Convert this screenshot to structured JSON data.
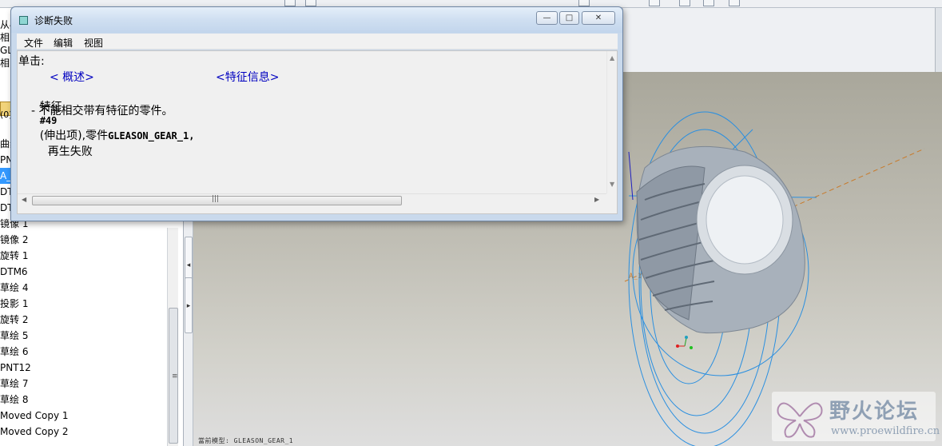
{
  "dialog": {
    "title": "诊断失败",
    "buttons": {
      "minimize": "—",
      "maximize": "□",
      "close": "✕"
    },
    "menu": [
      "文件",
      "编辑",
      "视图"
    ],
    "content": {
      "click_label": "单击:",
      "link_overview": "< 概述>",
      "link_feature_info": "<特征信息>",
      "feature_prefix": "特征",
      "feature_id": "#49",
      "feature_type": "(伸出项),",
      "part_prefix": "零件",
      "part_name": "GLEASON_GEAR_1,",
      "failure_text": "再生失败",
      "detail": "- 不能相交带有特征的零件。"
    },
    "h_scroll_grip": "|||"
  },
  "tree": {
    "peek_rows": [
      "从4",
      "相",
      "GL",
      "相"
    ],
    "counter": "(0)",
    "items": [
      {
        "label": "曲线",
        "selected": false
      },
      {
        "label": "PNT",
        "selected": false
      },
      {
        "label": "A_",
        "selected": true
      },
      {
        "label": "DTM",
        "selected": false
      },
      {
        "label": "DTM",
        "selected": false
      },
      {
        "label": "镜像 1",
        "selected": false
      },
      {
        "label": "镜像 2",
        "selected": false
      },
      {
        "label": "旋转 1",
        "selected": false
      },
      {
        "label": "DTM6",
        "selected": false
      },
      {
        "label": "草绘 4",
        "selected": false
      },
      {
        "label": "投影 1",
        "selected": false
      },
      {
        "label": "旋转 2",
        "selected": false
      },
      {
        "label": "草绘 5",
        "selected": false
      },
      {
        "label": "草绘 6",
        "selected": false
      },
      {
        "label": "PNT12",
        "selected": false
      },
      {
        "label": "草绘 7",
        "selected": false
      },
      {
        "label": "草绘 8",
        "selected": false
      },
      {
        "label": "Moved Copy 1",
        "selected": false
      },
      {
        "label": "Moved Copy 2",
        "selected": false
      }
    ],
    "scroll_grip": "≡"
  },
  "splitter": {
    "collapse": "◂",
    "expand": "▸"
  },
  "graphics": {
    "axis_label": "A_1",
    "status_model": "GLEASON_GEAR_1",
    "status_prefix": "當前模型:"
  },
  "watermark": {
    "title": "野火论坛",
    "url": "www.proewildfire.cn"
  }
}
